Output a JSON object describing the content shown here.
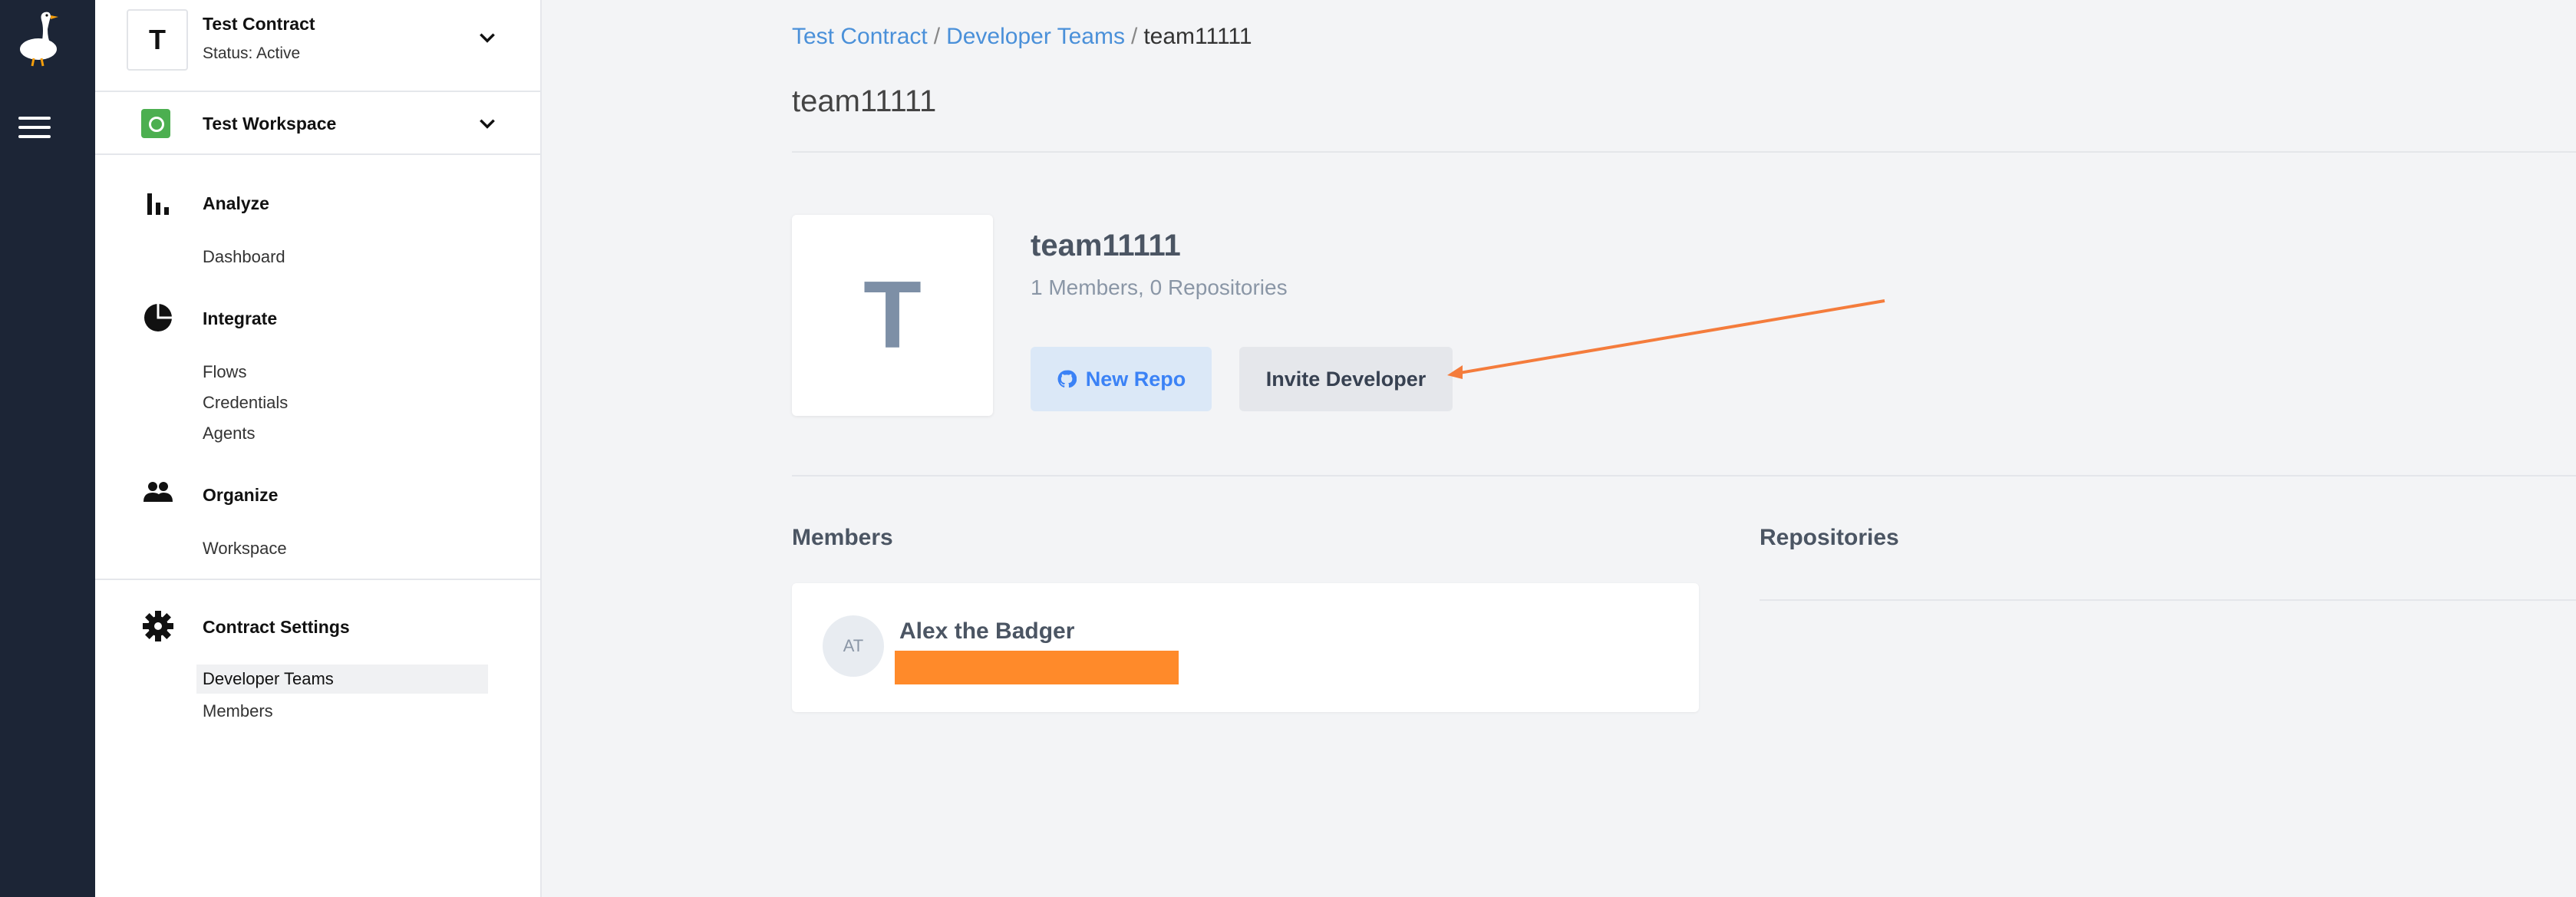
{
  "contract": {
    "initial": "T",
    "name": "Test Contract",
    "status": "Status: Active"
  },
  "workspace": {
    "name": "Test Workspace"
  },
  "sidebar": {
    "sections": [
      {
        "title": "Analyze",
        "icon": "bar-chart-icon",
        "items": [
          "Dashboard"
        ]
      },
      {
        "title": "Integrate",
        "icon": "pie-chart-icon",
        "items": [
          "Flows",
          "Credentials",
          "Agents"
        ]
      },
      {
        "title": "Organize",
        "icon": "people-icon",
        "items": [
          "Workspace"
        ]
      },
      {
        "title": "Contract Settings",
        "icon": "gear-icon",
        "items": [
          "Developer Teams",
          "Members"
        ]
      }
    ]
  },
  "breadcrumb": {
    "contract": "Test Contract",
    "teams": "Developer Teams",
    "current": "team11111",
    "separator": "/"
  },
  "page": {
    "title": "team11111"
  },
  "team": {
    "initial": "T",
    "name": "team11111",
    "stats": "1 Members, 0 Repositories"
  },
  "buttons": {
    "new_repo": "New Repo",
    "invite": "Invite Developer"
  },
  "members": {
    "title": "Members",
    "list": [
      {
        "initials": "AT",
        "name": "Alex the Badger"
      }
    ]
  },
  "repositories": {
    "title": "Repositories"
  },
  "colors": {
    "rail": "#1c2536",
    "link": "#4a90d9",
    "annotation_arrow": "#f47c3c",
    "redaction": "#ff8a2a",
    "workspace_badge": "#4caf50"
  }
}
